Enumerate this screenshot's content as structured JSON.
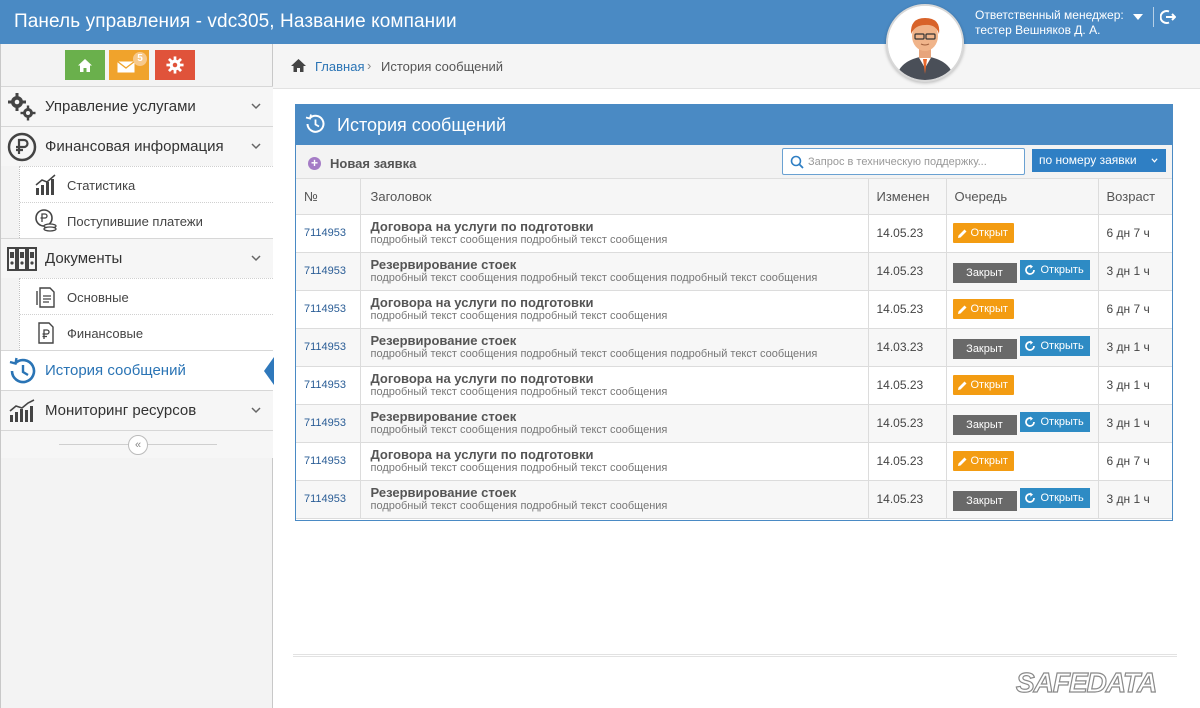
{
  "header": {
    "title": "Панель управления - vdc305, Название компании",
    "manager_line1": "Ответственный менеджер:",
    "manager_line2": "тестер Вешняков Д. А."
  },
  "sidebar": {
    "mail_badge": "5",
    "items": [
      {
        "label": "Управление услугами"
      },
      {
        "label": "Финансовая информация"
      },
      {
        "label": "Статистика"
      },
      {
        "label": "Поступившие платежи"
      },
      {
        "label": "Документы"
      },
      {
        "label": "Основные"
      },
      {
        "label": "Финансовые"
      },
      {
        "label": "История сообщений"
      },
      {
        "label": "Мониторинг ресурсов"
      }
    ],
    "collapse_glyph": "«"
  },
  "breadcrumb": {
    "home": "Главная",
    "separator": "›",
    "current": "История сообщений"
  },
  "panel": {
    "title": "История сообщений",
    "new_label": "Новая заявка",
    "search_placeholder": "Запрос в техническую поддержку...",
    "filter_label": "по номеру заявки"
  },
  "table": {
    "headers": {
      "num": "№",
      "subject": "Заголовок",
      "date": "Изменен",
      "queue": "Очередь",
      "age": "Возраст"
    },
    "open_label": "Открыт",
    "closed_label": "Закрыт",
    "reopen_label": "Открыть",
    "rows": [
      {
        "num": "7114953",
        "title": "Договора на услуги по подготовки",
        "desc": "подробный текст сообщения подробный текст сообщения",
        "date": "14.05.23",
        "status": "open",
        "age": "6 дн 7 ч"
      },
      {
        "num": "7114953",
        "title": "Резервирование стоек",
        "desc": "подробный текст сообщения подробный текст сообщения подробный текст сообщения",
        "date": "14.05.23",
        "status": "closed",
        "age": "3 дн 1 ч"
      },
      {
        "num": "7114953",
        "title": "Договора на услуги по подготовки",
        "desc": "подробный текст сообщения подробный текст сообщения",
        "date": "14.05.23",
        "status": "open",
        "age": "6 дн 7 ч"
      },
      {
        "num": "7114953",
        "title": "Резервирование стоек",
        "desc": "подробный текст сообщения подробный текст сообщения подробный текст сообщения",
        "date": "14.03.23",
        "status": "closed",
        "age": "3 дн 1 ч"
      },
      {
        "num": "7114953",
        "title": "Договора на услуги по подготовки",
        "desc": "подробный текст сообщения подробный текст сообщения",
        "date": "14.05.23",
        "status": "open",
        "age": "3 дн 1 ч"
      },
      {
        "num": "7114953",
        "title": "Резервирование стоек",
        "desc": "подробный текст сообщения подробный текст сообщения",
        "date": "14.05.23",
        "status": "closed",
        "age": "3 дн 1 ч"
      },
      {
        "num": "7114953",
        "title": "Договора на услуги по подготовки",
        "desc": "подробный текст сообщения подробный текст сообщения",
        "date": "14.05.23",
        "status": "open",
        "age": "6 дн 7 ч"
      },
      {
        "num": "7114953",
        "title": "Резервирование стоек",
        "desc": "подробный текст сообщения подробный текст сообщения",
        "date": "14.05.23",
        "status": "closed",
        "age": "3 дн 1 ч"
      }
    ]
  },
  "footer": {
    "logo_text": "SAFEDATA"
  },
  "colors": {
    "header_blue": "#4a8ac4",
    "open_orange": "#f39c12",
    "closed_gray": "#696969",
    "reopen_blue": "#2e8bc4",
    "link_blue": "#2a74b5"
  },
  "icons": [
    "home-icon",
    "mail-icon",
    "gear-icon",
    "gears-icon",
    "ruble-icon",
    "chart-icon",
    "coins-icon",
    "binders-icon",
    "document-icon",
    "ruble-document-icon",
    "history-icon",
    "monitoring-icon",
    "chevron-down-icon",
    "search-icon",
    "pencil-icon",
    "refresh-icon",
    "logout-icon",
    "plus-icon",
    "avatar"
  ]
}
